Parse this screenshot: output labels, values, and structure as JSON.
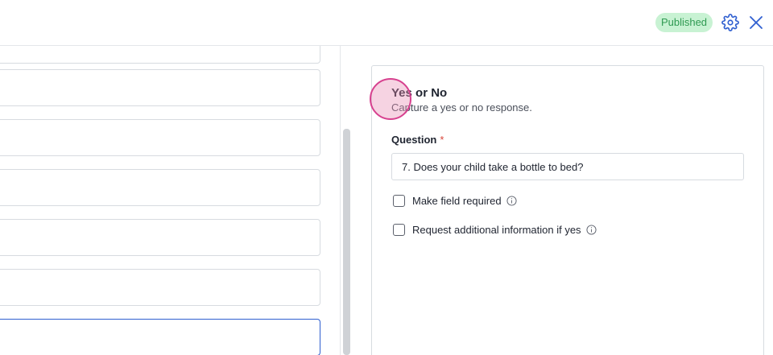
{
  "header": {
    "status_badge": "Published",
    "settings_icon": "gear-icon",
    "close_icon": "close-icon",
    "accent_color": "#2f5fd0",
    "badge_bg": "#c8f2d3",
    "badge_fg": "#2f9a52"
  },
  "editor": {
    "title": "Yes or No",
    "subtitle": "Capture a yes or no response.",
    "question_label": "Question",
    "required_marker": "*",
    "question_value": "7. Does your child take a bottle to bed?",
    "options": [
      {
        "label": "Make field required",
        "checked": false,
        "info_icon": "info-icon"
      },
      {
        "label": "Request additional information if yes",
        "checked": false,
        "info_icon": "info-icon"
      }
    ]
  }
}
